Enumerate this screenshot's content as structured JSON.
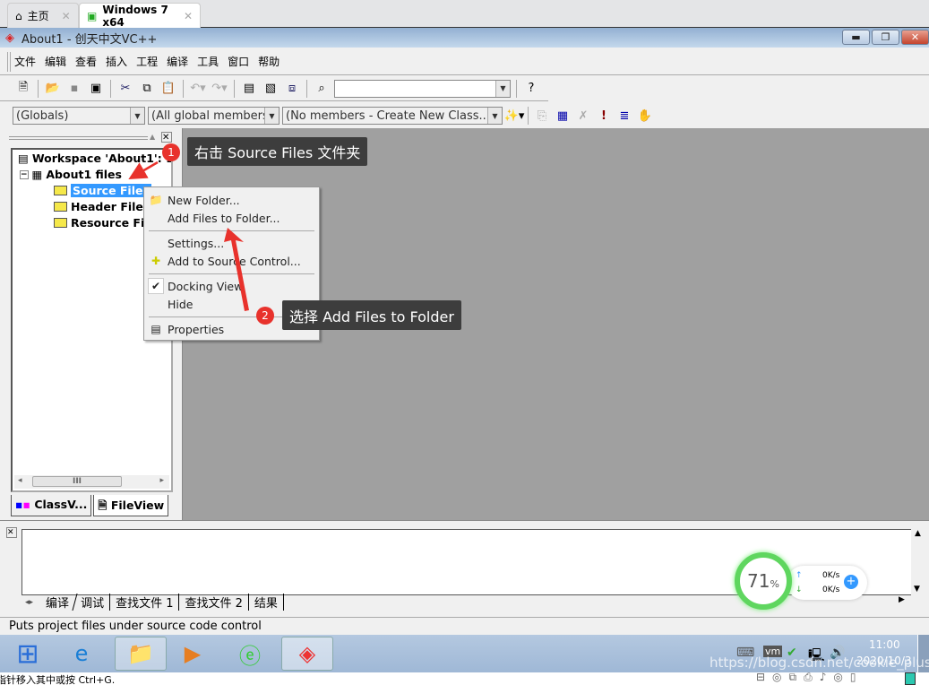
{
  "browser_tabs": [
    {
      "label": "主页",
      "icon": "home-icon"
    },
    {
      "label": "Windows 7 x64",
      "icon": "vm-play-icon"
    }
  ],
  "window": {
    "title": "About1 - 创天中文VC++"
  },
  "menu": [
    "文件",
    "编辑",
    "查看",
    "插入",
    "工程",
    "编译",
    "工具",
    "窗口",
    "帮助"
  ],
  "toolbar2": {
    "globals": "(Globals)",
    "members": "(All global members",
    "class": "(No members - Create New Class...)"
  },
  "tree": {
    "workspace": "Workspace 'About1': 1",
    "project": "About1 files",
    "folders": [
      "Source Files",
      "Header Files",
      "Resource Fil"
    ]
  },
  "panel_tabs": [
    "ClassV...",
    "FileView"
  ],
  "context_menu": [
    {
      "label": "New Folder...",
      "icon": "new-folder-icon"
    },
    {
      "label": "Add Files to Folder..."
    },
    {
      "label": "Settings..."
    },
    {
      "label": "Add to Source Control...",
      "icon": "source-control-icon"
    },
    {
      "label": "Docking View",
      "checked": true
    },
    {
      "label": "Hide"
    },
    {
      "label": "Properties",
      "icon": "properties-icon"
    }
  ],
  "annotations": [
    {
      "num": "1",
      "text": "右击 Source Files 文件夹"
    },
    {
      "num": "2",
      "text": "选择 Add Files to Folder"
    }
  ],
  "output_tabs": [
    "编译",
    "调试",
    "查找文件 1",
    "查找文件 2",
    "结果"
  ],
  "net_widget": {
    "percent": "71",
    "unit": "%",
    "up": "0K/s",
    "down": "0K/s"
  },
  "status": "Puts project files under source code control",
  "clock": {
    "time": "11:00",
    "date": "2020/10/3"
  },
  "watermark": "https://blog.csdn.net/cookie_plus",
  "bottom_hint": "指针移入其中或按 Ctrl+G."
}
